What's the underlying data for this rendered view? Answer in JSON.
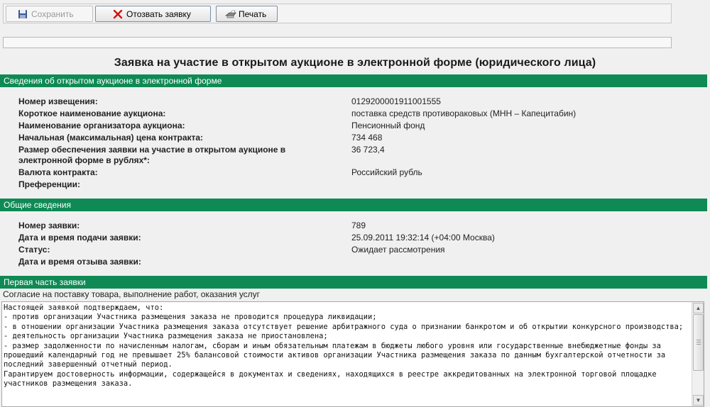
{
  "toolbar": {
    "save_label": "Сохранить",
    "withdraw_label": "Отозвать заявку",
    "print_label": "Печать"
  },
  "page_title": "Заявка на участие в открытом аукционе в электронной форме (юридического лица)",
  "section_auction": {
    "title": "Сведения об открытом аукционе в электронной форме",
    "rows": [
      {
        "label": "Номер извещения:",
        "value": "0129200001911001555"
      },
      {
        "label": "Короткое наименование аукциона:",
        "value": "поставка средств противораковых (МНН – Капецитабин)"
      },
      {
        "label": "Наименование организатора аукциона:",
        "value": "Пенсионный фонд"
      },
      {
        "label": "Начальная (максимальная) цена контракта:",
        "value": "734 468"
      },
      {
        "label": "Размер обеспечения заявки на участие в открытом аукционе в электронной форме в рублях*:",
        "value": "36 723,4"
      },
      {
        "label": "Валюта контракта:",
        "value": "Российский рубль"
      },
      {
        "label": "Преференции:",
        "value": ""
      }
    ]
  },
  "section_general": {
    "title": "Общие сведения",
    "rows": [
      {
        "label": "Номер заявки:",
        "value": "789"
      },
      {
        "label": "Дата и время подачи заявки:",
        "value": "25.09.2011 19:32:14 (+04:00 Москва)"
      },
      {
        "label": "Статус:",
        "value": "Ожидает рассмотрения"
      },
      {
        "label": "Дата и время отзыва заявки:",
        "value": ""
      }
    ]
  },
  "section_first_part": {
    "title": "Первая часть заявки",
    "subtitle": "Согласие на поставку товара, выполнение работ, оказания услуг",
    "text": "Настоящей заявкой подтверждаем, что:\n- против организации Участника размещения заказа не проводится процедура ликвидации;\n- в отношении организации Участника размещения заказа отсутствует решение арбитражного суда о признании банкротом и об открытии конкурсного производства;\n- деятельность организации Участника размещения заказа не приостановлена;\n- размер задолженности по начисленным налогам, сборам и иным обязательным платежам в бюджеты любого уровня или государственные внебюджетные фонды за прошедший календарный год не превышает 25% балансовой стоимости активов организации Участника размещения заказа по данным бухгалтерской отчетности за последний завершенный отчетный период.\nГарантируем достоверность информации, содержащейся в документах и сведениях, находящихся в реестре аккредитованных на электронной торговой площадке участников размещения заказа."
  },
  "icons": {
    "save": "floppy-disk-icon",
    "withdraw": "red-x-icon",
    "print": "printer-icon",
    "scroll_up": "scroll-up-arrow-icon",
    "scroll_down": "scroll-down-arrow-icon"
  },
  "colors": {
    "section_header": "#0f8a55",
    "withdraw_icon": "#d01010"
  }
}
